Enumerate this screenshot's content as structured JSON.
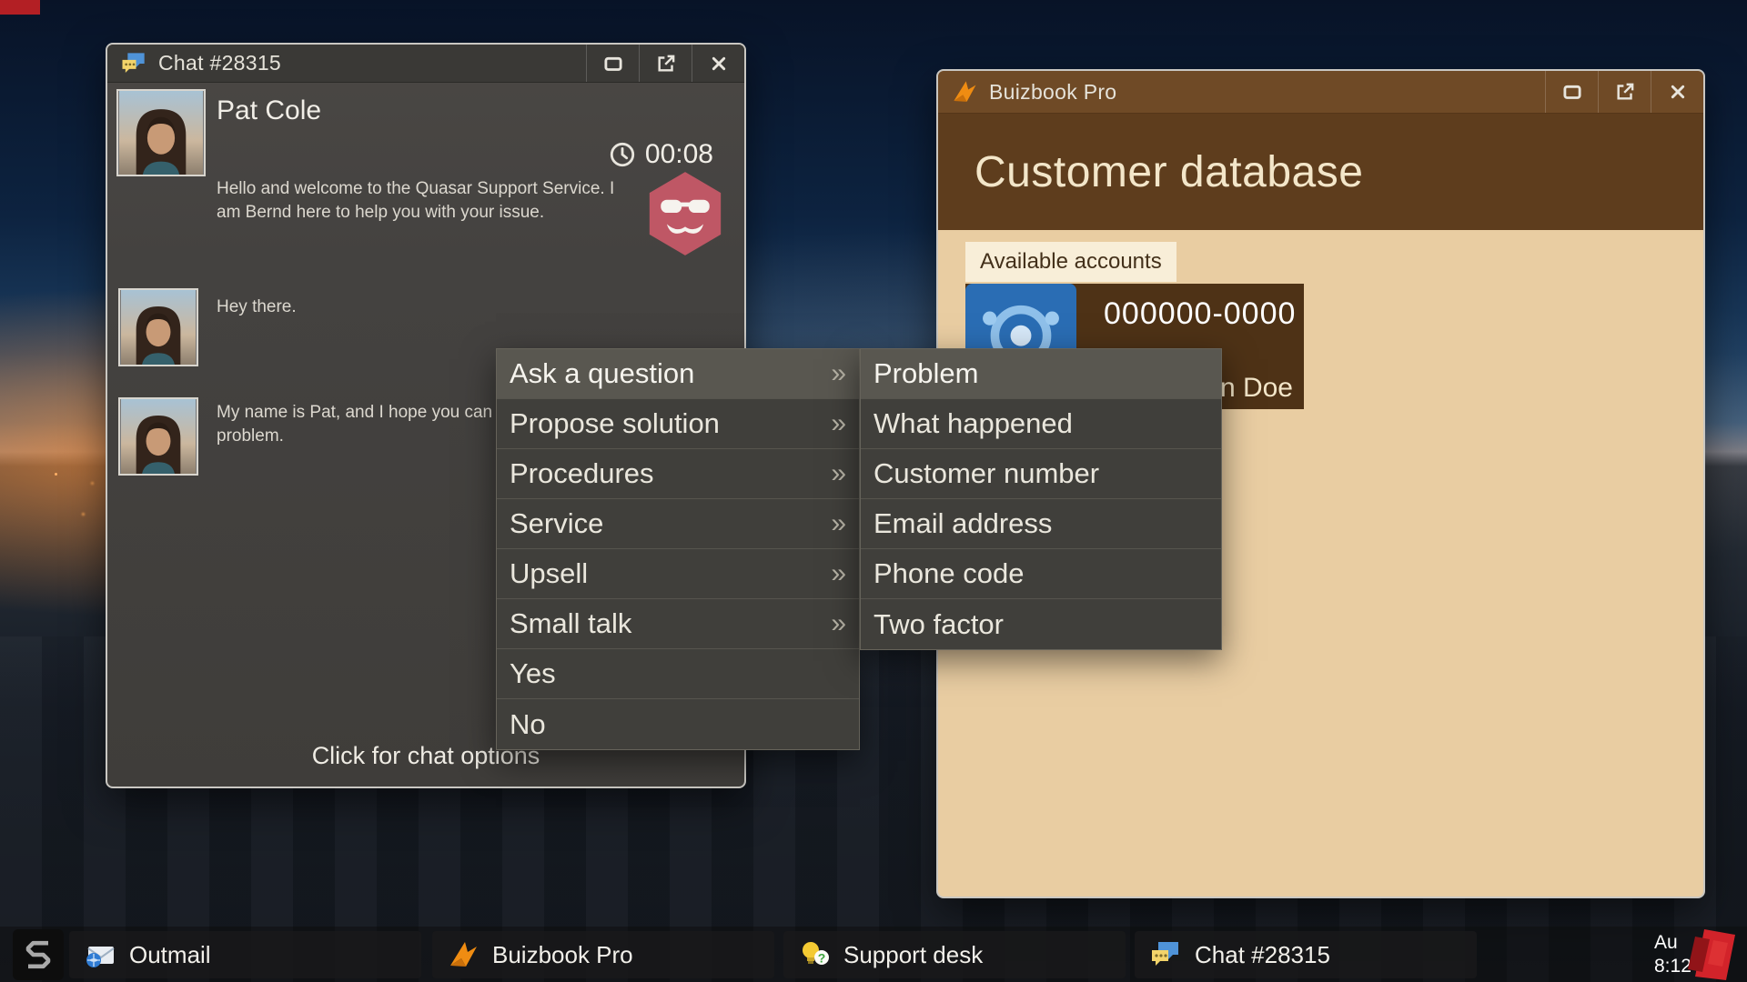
{
  "chat_window": {
    "title": "Chat #28315",
    "contact_name": "Pat Cole",
    "timer": "00:08",
    "messages": [
      {
        "from": "support_agent",
        "text": "Hello and welcome to the Quasar Support Service. I am Bernd here to help you with your issue."
      },
      {
        "from": "customer",
        "text": "Hey there."
      },
      {
        "from": "customer",
        "text": "My name is Pat, and I hope you can\nproblem."
      }
    ],
    "footer_label": "Click for chat options"
  },
  "chat_menu": {
    "items": [
      {
        "label": "Ask a question",
        "has_submenu": true,
        "active": true
      },
      {
        "label": "Propose solution",
        "has_submenu": true,
        "active": false
      },
      {
        "label": "Procedures",
        "has_submenu": true,
        "active": false
      },
      {
        "label": "Service",
        "has_submenu": true,
        "active": false
      },
      {
        "label": "Upsell",
        "has_submenu": true,
        "active": false
      },
      {
        "label": "Small talk",
        "has_submenu": true,
        "active": false
      },
      {
        "label": "Yes",
        "has_submenu": false,
        "active": false
      },
      {
        "label": "No",
        "has_submenu": false,
        "active": false
      }
    ],
    "submenu_items": [
      {
        "label": "Problem",
        "active": true
      },
      {
        "label": "What happened",
        "active": false
      },
      {
        "label": "Customer number",
        "active": false
      },
      {
        "label": "Email address",
        "active": false
      },
      {
        "label": "Phone code",
        "active": false
      },
      {
        "label": "Two factor",
        "active": false
      }
    ]
  },
  "buizbook_window": {
    "title": "Buizbook Pro",
    "heading": "Customer database",
    "accounts_label": "Available accounts",
    "account": {
      "number": "000000-0000",
      "name_visible": "n Doe"
    }
  },
  "taskbar": {
    "items": [
      {
        "label": "Outmail",
        "icon": "mail-icon"
      },
      {
        "label": "Buizbook Pro",
        "icon": "bird-icon"
      },
      {
        "label": "Support desk",
        "icon": "bulb-icon"
      },
      {
        "label": "Chat #28315",
        "icon": "chat-icon"
      }
    ],
    "clock": {
      "date": "Au",
      "time": "8:12"
    }
  },
  "icons": {
    "chat": "speech-bubbles",
    "mail": "envelope-globe",
    "bird": "origami-bird",
    "bulb": "lightbulb-question",
    "clock": "clock-face",
    "minimize": "window-restore",
    "popout": "external-window",
    "close": "x-cross",
    "submenu_chevron": "»",
    "account": "network-hub",
    "start_logo": "quasar-s",
    "watermark": "press-logo"
  },
  "colors": {
    "menu_bg": "#403f3b",
    "menu_highlight": "#595750",
    "chat_window_bg": "#44423f",
    "chat_titlebar_bg": "#3a3936",
    "buizbook_titlebar_bg": "#6f4a26",
    "buizbook_header_bg": "#5e3d1d",
    "buizbook_body_bg": "#e9cda2",
    "account_strip_bg": "#4e3216",
    "agent_avatar_hex": "#bf5765",
    "watermark_red": "#d2232a"
  }
}
